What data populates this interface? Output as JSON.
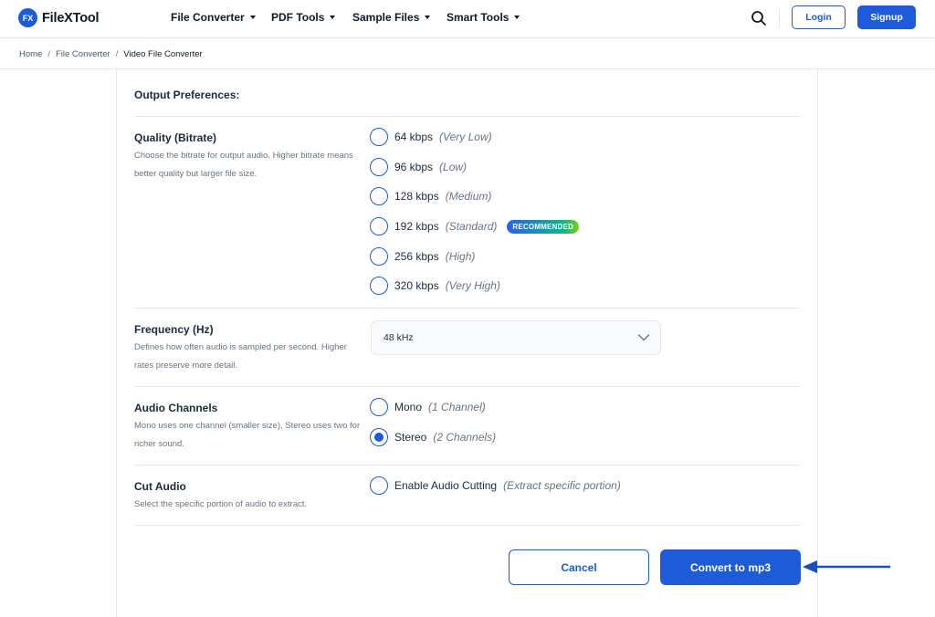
{
  "header": {
    "logo_badge": "FX",
    "logo_text": "FileXTool",
    "menu": [
      {
        "label": "File Converter"
      },
      {
        "label": "PDF Tools"
      },
      {
        "label": "Sample Files"
      },
      {
        "label": "Smart Tools"
      }
    ],
    "search_icon": "search-icon",
    "login_label": "Login",
    "signup_label": "Signup"
  },
  "breadcrumb": {
    "items": [
      "Home",
      "File Converter",
      "Video File Converter"
    ],
    "separator": "/"
  },
  "output_preferences": {
    "title": "Output Preferences:",
    "quality": {
      "title": "Quality (Bitrate)",
      "description": "Choose the bitrate for output audio. Higher bitrate means better quality but larger file size.",
      "options": [
        {
          "label": "64 kbps",
          "hint": "(Very Low)",
          "selected": false
        },
        {
          "label": "96 kbps",
          "hint": "(Low)",
          "selected": false
        },
        {
          "label": "128 kbps",
          "hint": "(Medium)",
          "selected": false
        },
        {
          "label": "192 kbps",
          "hint": "(Standard)",
          "selected": false,
          "badge": "RECOMMENDED"
        },
        {
          "label": "256 kbps",
          "hint": "(High)",
          "selected": false
        },
        {
          "label": "320 kbps",
          "hint": "(Very High)",
          "selected": false
        }
      ]
    },
    "frequency": {
      "title": "Frequency (Hz)",
      "description": "Defines how often audio is sampled per second. Higher rates preserve more detail.",
      "selected_value": "48 kHz"
    },
    "channels": {
      "title": "Audio Channels",
      "description": "Mono uses one channel (smaller size), Stereo uses two for richer sound.",
      "options": [
        {
          "label": "Mono",
          "hint": "(1 Channel)",
          "selected": false
        },
        {
          "label": "Stereo",
          "hint": "(2 Channels)",
          "selected": true
        }
      ]
    },
    "cut_audio": {
      "title": "Cut Audio",
      "description": "Select the specific portion of audio to extract.",
      "option": {
        "label": "Enable Audio Cutting",
        "hint": "(Extract specific portion)",
        "selected": false
      }
    }
  },
  "actions": {
    "cancel_label": "Cancel",
    "convert_label": "Convert to mp3"
  },
  "colors": {
    "primary": "#1d5bd8",
    "arrow": "#1a4fbf"
  }
}
